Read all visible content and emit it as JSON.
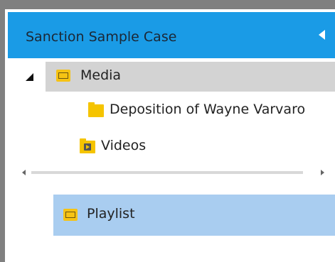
{
  "header": {
    "title": "Sanction Sample Case",
    "collapse_icon": "chevron-left-icon",
    "background_color": "#1a9be6"
  },
  "tree": {
    "items": [
      {
        "label": "Media",
        "icon": "media-folder-icon",
        "expanded": true,
        "selected": true
      },
      {
        "label": "Deposition of Wayne Varvaro",
        "icon": "folder-icon"
      },
      {
        "label": "Videos",
        "icon": "video-folder-icon"
      }
    ]
  },
  "scrollbar": {
    "left_icon": "scroll-left-icon",
    "right_icon": "scroll-right-icon"
  },
  "playlist": {
    "label": "Playlist",
    "icon": "playlist-icon",
    "background_color": "#a9cdf0"
  }
}
